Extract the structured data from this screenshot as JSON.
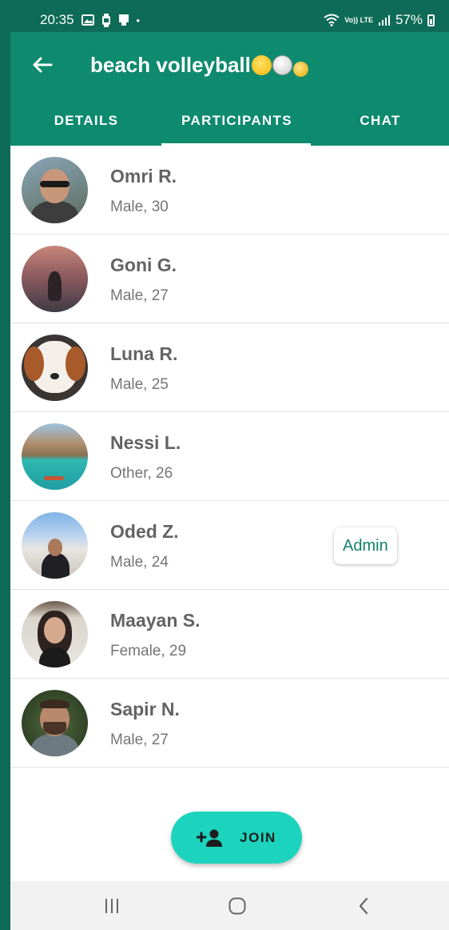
{
  "status_bar": {
    "time": "20:35",
    "dot": "•",
    "network": "Vo)) LTE",
    "battery": "57%"
  },
  "header": {
    "title": "beach volleyball",
    "title_emoji": [
      "smiling-face-with-halo",
      "volleyball",
      "gold-medal"
    ],
    "back_icon": "arrow-left-icon",
    "tabs": [
      {
        "label": "DETAILS",
        "selected": false
      },
      {
        "label": "PARTICIPANTS",
        "selected": true
      },
      {
        "label": "CHAT",
        "selected": false
      }
    ]
  },
  "participants": [
    {
      "name": "Omri R.",
      "meta": "Male, 30"
    },
    {
      "name": "Goni G.",
      "meta": "Male, 27"
    },
    {
      "name": "Luna R.",
      "meta": "Male, 25"
    },
    {
      "name": "Nessi L.",
      "meta": "Other, 26"
    },
    {
      "name": "Oded Z.",
      "meta": "Male, 24",
      "badge": "Admin"
    },
    {
      "name": "Maayan S.",
      "meta": "Female, 29"
    },
    {
      "name": "Sapir N.",
      "meta": "Male, 27"
    }
  ],
  "join_button": {
    "label": "JOIN",
    "icon": "add-person-icon"
  },
  "nav_bar": {
    "icons": [
      "recent-apps-icon",
      "home-icon",
      "back-icon"
    ]
  },
  "colors": {
    "status_bar": "#0e6b57",
    "app_bar": "#0e8a6e",
    "fab": "#1cd4be",
    "accent_text": "#13806a"
  }
}
